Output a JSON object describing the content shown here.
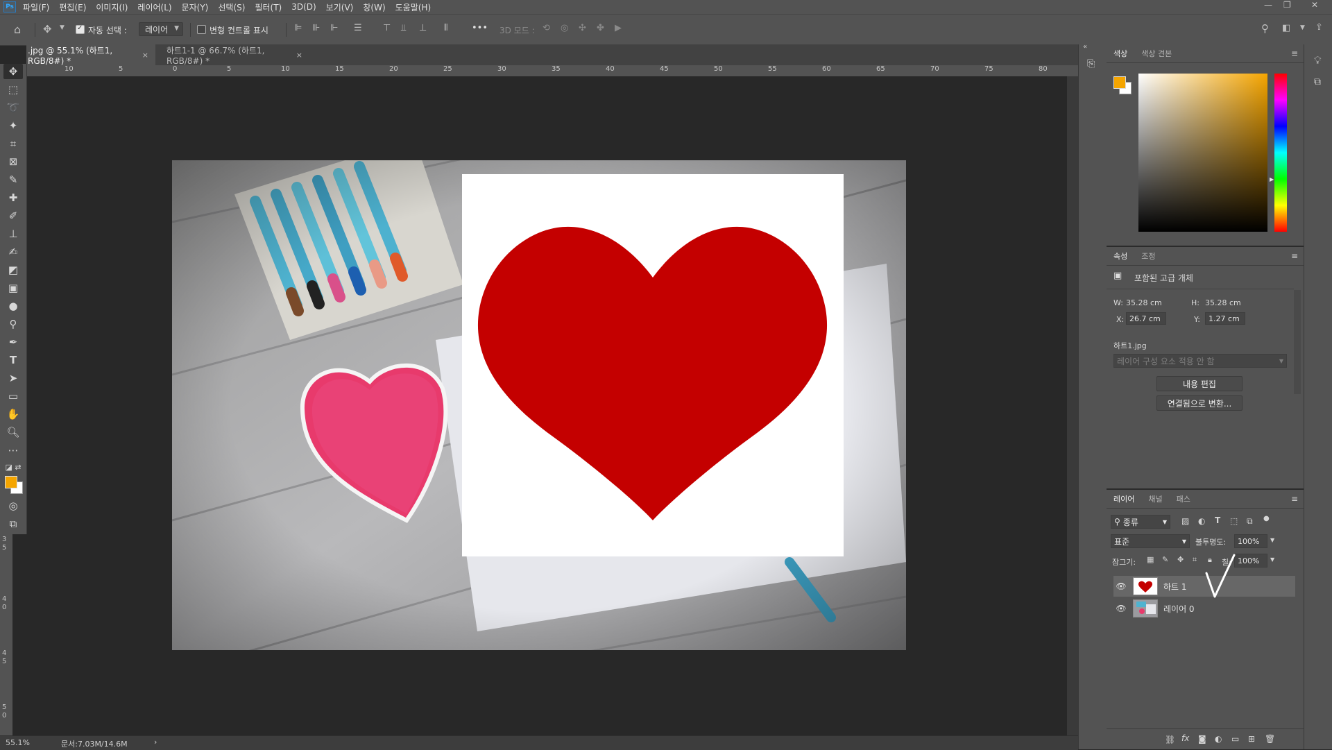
{
  "app": {
    "logo": "Ps"
  },
  "menu": [
    "파일(F)",
    "편집(E)",
    "이미지(I)",
    "레이어(L)",
    "문자(Y)",
    "선택(S)",
    "필터(T)",
    "3D(D)",
    "보기(V)",
    "창(W)",
    "도움말(H)"
  ],
  "options": {
    "auto_select_label": "자동 선택 :",
    "auto_select_value": "레이어",
    "transform_controls_label": "변형 컨트롤 표시",
    "more": "•••",
    "mode_3d_label": "3D 모드 :"
  },
  "tabs": [
    {
      "label": ".jpg @ 55.1% (하트1, RGB/8#) *",
      "close": "×"
    },
    {
      "label": "하트1-1 @ 66.7% (하트1, RGB/8#) *",
      "close": "×"
    }
  ],
  "ruler": [
    "10",
    "5",
    "0",
    "5",
    "10",
    "15",
    "20",
    "25",
    "30",
    "35",
    "40",
    "45",
    "50",
    "55",
    "60",
    "65",
    "70",
    "75",
    "80"
  ],
  "ruler_v": [
    "3",
    "5",
    "4",
    "0",
    "4",
    "5",
    "5",
    "0"
  ],
  "status": {
    "zoom": "55.1%",
    "doc": "문서:7.03M/14.6M",
    "arrow": "›"
  },
  "colors": {
    "foreground": "#f5a500",
    "background": "#ffffff",
    "heart_red": "#c40000"
  },
  "color_panel": {
    "tabs": [
      "색상",
      "색상 견본"
    ]
  },
  "properties": {
    "tabs": [
      "속성",
      "조정"
    ],
    "type": "포함된 고급 개체",
    "w_label": "W:",
    "w_value": "35.28 cm",
    "h_label": "H:",
    "h_value": "35.28 cm",
    "x_label": "X:",
    "x_value": "26.7 cm",
    "y_label": "Y:",
    "y_value": "1.27 cm",
    "filename": "하트1.jpg",
    "comp_placeholder": "레이어 구성 요소 적용 안 함",
    "edit_button": "내용 편집",
    "convert_button": "연결됨으로 변환..."
  },
  "layers": {
    "tabs": [
      "레이어",
      "채널",
      "패스"
    ],
    "filter": "종류",
    "blend": "표준",
    "opacity_label": "불투명도:",
    "opacity_value": "100%",
    "lock_label": "잠그기:",
    "fill_label": "칠:",
    "fill_value": "100%",
    "items": [
      {
        "name": "하트 1",
        "selected": true
      },
      {
        "name": "레이어 0",
        "selected": false
      }
    ]
  }
}
